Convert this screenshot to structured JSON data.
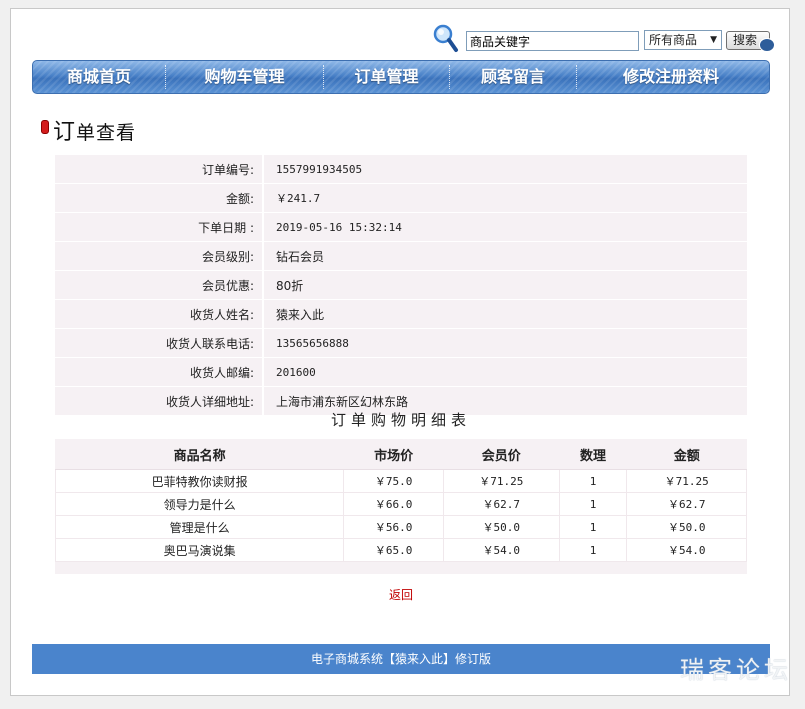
{
  "search": {
    "value": "商品关键字",
    "category": "所有商品",
    "button_label": "搜索"
  },
  "nav": {
    "items": [
      {
        "label": "商城首页"
      },
      {
        "label": "购物车管理"
      },
      {
        "label": "订单管理"
      },
      {
        "label": "顾客留言"
      },
      {
        "label": "修改注册资料"
      }
    ]
  },
  "page": {
    "title_first": "订",
    "title_rest": "单查看"
  },
  "order": {
    "fields": [
      {
        "label": "订单编号:",
        "value": "1557991934505"
      },
      {
        "label": "金额:",
        "value": "￥241.7"
      },
      {
        "label": "下单日期 :",
        "value": "2019-05-16 15:32:14"
      },
      {
        "label": "会员级别:",
        "value": "钻石会员"
      },
      {
        "label": "会员优惠:",
        "value": "80折"
      },
      {
        "label": "收货人姓名:",
        "value": "猿来入此"
      },
      {
        "label": "收货人联系电话:",
        "value": "13565656888"
      },
      {
        "label": "收货人邮编:",
        "value": "201600"
      },
      {
        "label": "收货人详细地址:",
        "value": "上海市浦东新区幻林东路"
      }
    ]
  },
  "details": {
    "title": "订单购物明细表",
    "columns": [
      "商品名称",
      "市场价",
      "会员价",
      "数理",
      "金额"
    ],
    "rows": [
      [
        "巴菲特教你读财报",
        "￥75.0",
        "￥71.25",
        "1",
        "￥71.25"
      ],
      [
        "领导力是什么",
        "￥66.0",
        "￥62.7",
        "1",
        "￥62.7"
      ],
      [
        "管理是什么",
        "￥56.0",
        "￥50.0",
        "1",
        "￥50.0"
      ],
      [
        "奥巴马演说集",
        "￥65.0",
        "￥54.0",
        "1",
        "￥54.0"
      ]
    ]
  },
  "back_label": "返回",
  "footer": {
    "text": "电子商城系统【猿来入此】修订版",
    "watermark": "瑞客论坛"
  },
  "colors": {
    "nav": "#4a82c8",
    "footer": "#4a84cc",
    "back_link": "#c00000",
    "table_bg": "#f6f1f4"
  }
}
